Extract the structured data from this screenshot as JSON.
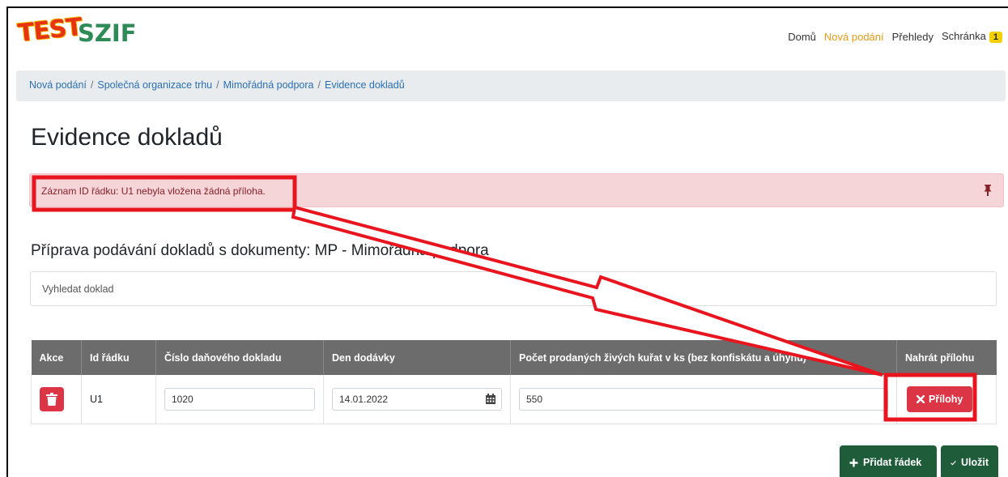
{
  "logo": {
    "test": "TEST",
    "brand": "SZIF"
  },
  "nav": {
    "items": [
      {
        "label": "Domů"
      },
      {
        "label": "Nová podání"
      },
      {
        "label": "Přehledy"
      },
      {
        "label": "Schránka"
      }
    ],
    "inbox_count": "1"
  },
  "breadcrumb": [
    {
      "label": "Nová podání"
    },
    {
      "label": "Společná organizace trhu"
    },
    {
      "label": "Mimořádná podpora"
    },
    {
      "label": "Evidence dokladů"
    }
  ],
  "page_title": "Evidence dokladů",
  "alert": {
    "message": "Záznam ID řádku: U1 nebyla vložena žádná příloha."
  },
  "section_title": "Příprava podávání dokladů s dokumenty: MP - Mimořádná podpora",
  "search": {
    "placeholder": "Vyhledat doklad"
  },
  "table": {
    "headers": [
      "Akce",
      "Id řádku",
      "Číslo daňového dokladu",
      "Den dodávky",
      "Počet prodaných živých kuřat v ks (bez konfiskátu a úhynu)",
      "Nahrát přílohu"
    ],
    "rows": [
      {
        "id": "U1",
        "doc_number": "1020",
        "delivery_date": "14.01.2022",
        "count": "550",
        "attach_label": "Přílohy"
      }
    ]
  },
  "actions": {
    "add_row": "Přidat řádek",
    "save": "Uložit"
  },
  "colors": {
    "danger": "#dc3545",
    "primary_green": "#1e5c3a",
    "annotation": "#e8141e",
    "active_nav": "#e99a12"
  }
}
